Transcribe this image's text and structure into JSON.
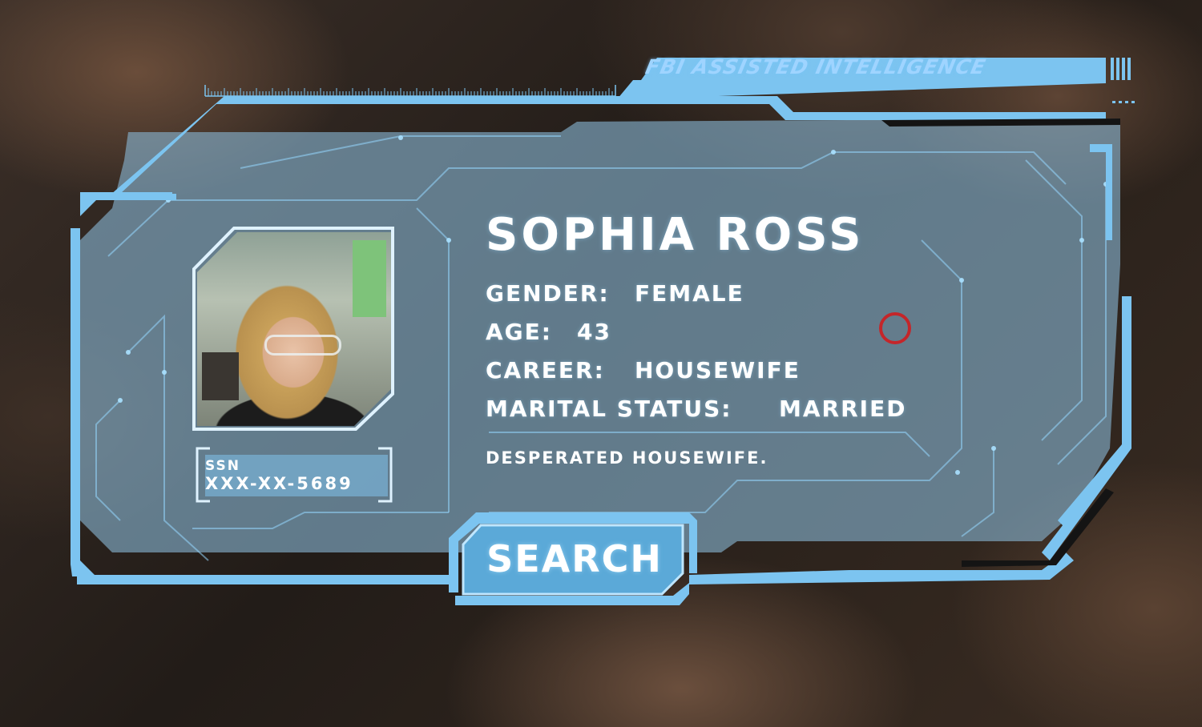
{
  "header": {
    "title": "FBI ASSISTED INTELLIGENCE"
  },
  "profile": {
    "name": "SOPHIA ROSS",
    "gender_label": "GENDER:",
    "gender": "FEMALE",
    "age_label": "AGE:",
    "age": "43",
    "career_label": "CAREER:",
    "career": "HOUSEWIFE",
    "marital_label": "MARITAL STATUS:",
    "marital": "MARRIED",
    "description": "DESPERATED HOUSEWIFE.",
    "ssn_label": "SSN",
    "ssn": "XXX-XX-5689"
  },
  "actions": {
    "search_label": "SEARCH"
  },
  "colors": {
    "frame": "#7cc4f0",
    "panel": "#8fb8d2",
    "cursor": "#c4262a"
  },
  "icons": {
    "cursor": "red-ring-cursor-icon"
  }
}
